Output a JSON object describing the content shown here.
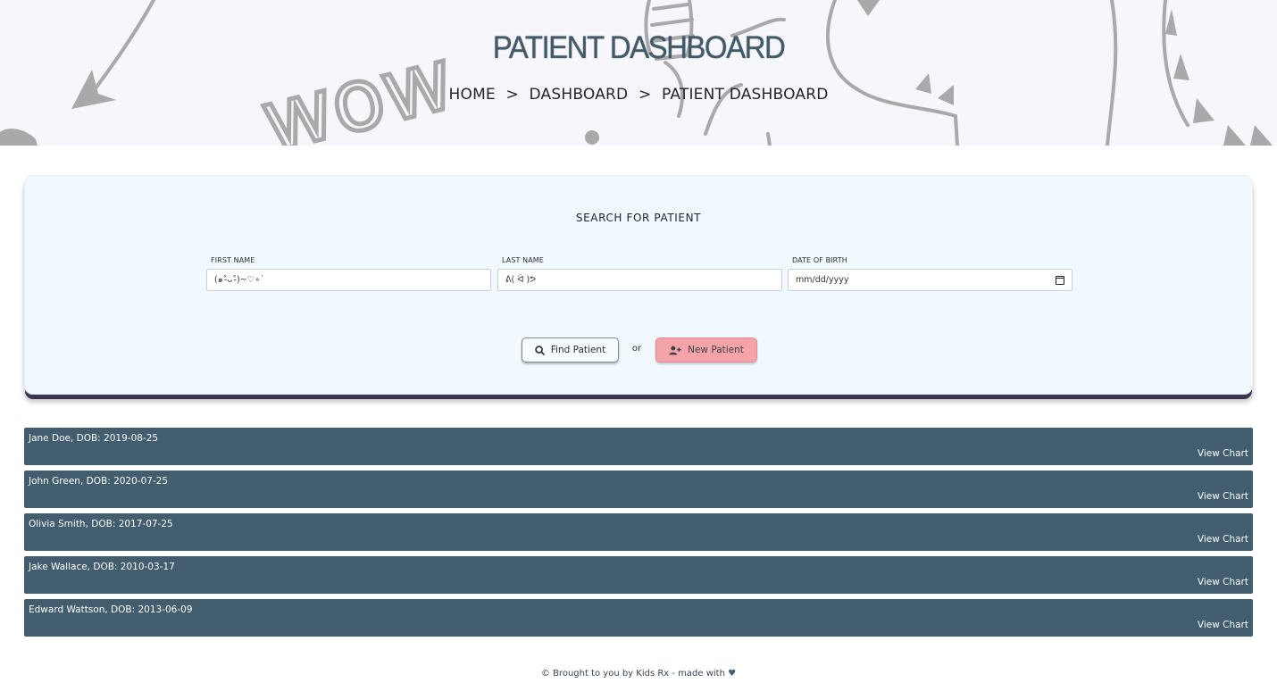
{
  "hero": {
    "title": "PATIENT DASHBOARD",
    "doodle_text": "wow",
    "breadcrumb": [
      {
        "label": "HOME"
      },
      {
        "label": "DASHBOARD"
      },
      {
        "label": "PATIENT DASHBOARD"
      }
    ],
    "breadcrumb_separator": ">"
  },
  "search": {
    "title": "SEARCH FOR PATIENT",
    "fields": {
      "first_name": {
        "label": "FIRST NAME",
        "value": "(๑˃̵ᴗ˂̵)~♡∘˙"
      },
      "last_name": {
        "label": "LAST NAME",
        "value": "ᕕ( ᐛ )ᕗ"
      },
      "dob": {
        "label": "DATE OF BIRTH",
        "value": "mm/dd/yyyy",
        "icon": "calendar-icon"
      }
    },
    "find_button": {
      "label": "Find Patient",
      "icon": "search-icon"
    },
    "or_text": "or",
    "new_button": {
      "label": "New Patient",
      "icon": "user-plus-icon"
    }
  },
  "patients": [
    {
      "name": "Jane Doe, DOB: 2019-08-25",
      "action": "View Chart"
    },
    {
      "name": "John Green, DOB: 2020-07-25",
      "action": "View Chart"
    },
    {
      "name": "Olivia Smith, DOB: 2017-07-25",
      "action": "View Chart"
    },
    {
      "name": "Jake Wallace, DOB: 2010-03-17",
      "action": "View Chart"
    },
    {
      "name": "Edward Wattson, DOB: 2013-06-09",
      "action": "View Chart"
    }
  ],
  "footer": {
    "text": "© Brought to you by Kids Rx - made with",
    "heart": "♥"
  },
  "colors": {
    "hero_bg": "#f6f6fb",
    "title": "#425a67",
    "card_bg": "#f2f9fe",
    "row_bg": "#425e6e",
    "new_button": "#f4a4a9",
    "doodle": "#a9a9ab"
  }
}
